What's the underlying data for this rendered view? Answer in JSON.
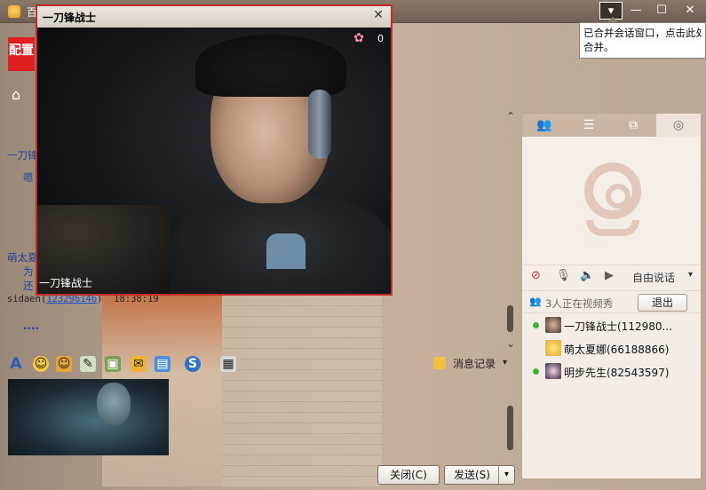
{
  "main_window": {
    "title_fragment": "百",
    "minimize": "—",
    "maximize": "☐",
    "close": "✕",
    "merge_icon": "▾",
    "home_icon": "⌂"
  },
  "tooltip": {
    "line1": "已合并会话窗口，点击此处",
    "line2": "合并。"
  },
  "logo": {
    "text": "配置"
  },
  "history": {
    "line1": "一刀锋",
    "tag1": "嗯",
    "line2": "萌太夏",
    "tag2": "为",
    "tag3": "还",
    "sender_name": "sidaen",
    "sender_uid": "123296146",
    "sender_time": "18:38:19",
    "dots": "....",
    "scroll_up": "⌃",
    "scroll_down": "⌄"
  },
  "toolbar": {
    "font": "A",
    "emoji": "☺",
    "items": [
      "☺",
      "✎",
      "▣",
      "✉",
      "▤",
      "S",
      "▦"
    ],
    "message_record": "消息记录",
    "caret": "▾"
  },
  "buttons": {
    "close": "关闭(C)",
    "send": "发送(S)",
    "send_caret": "▾"
  },
  "video": {
    "title": "一刀锋战士",
    "close": "✕",
    "label": "一刀锋战士",
    "flower_icon": "✿",
    "flower_count": "0"
  },
  "right_panel": {
    "tabs": [
      "👥",
      "☰",
      "⧉",
      "◎"
    ],
    "speak_mode": "自由说话",
    "speak_caret": "▾",
    "count_text": "3人正在视频秀",
    "exit": "退出",
    "members": [
      {
        "name": "一刀锋战士(112980...",
        "online": true
      },
      {
        "name": "萌太夏娜(66188866)",
        "online": false
      },
      {
        "name": "明步先生(82543597)",
        "online": true
      }
    ]
  }
}
